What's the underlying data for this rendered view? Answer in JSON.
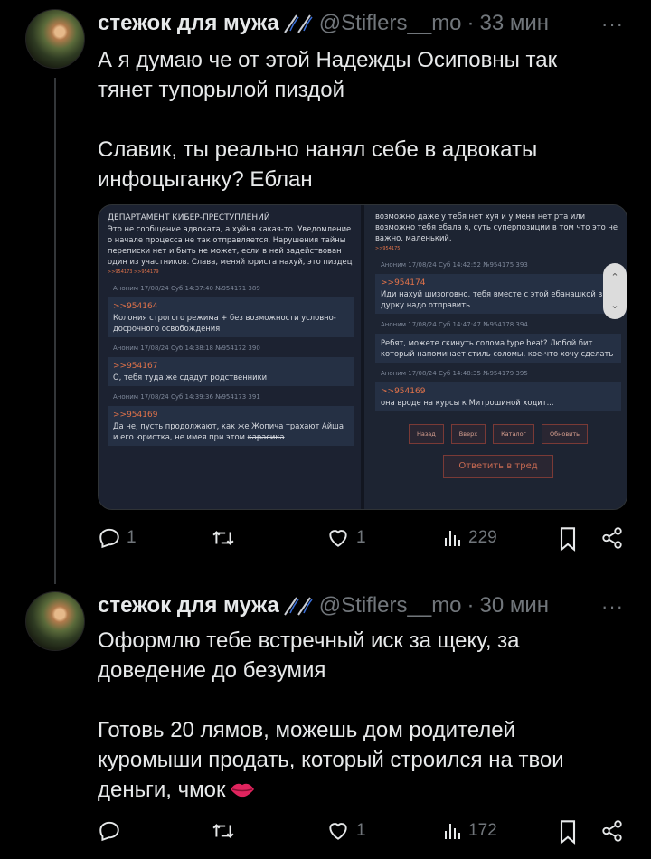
{
  "posts": [
    {
      "display_name": "стежок для мужа",
      "handle": "@Stiflers__mo",
      "separator": "·",
      "time": "33 мин",
      "more": "···",
      "paragraphs": [
        "А я думаю че от этой Надежды Осиповны так тянет тупорылой пиздой",
        "Славик, ты реально нанял себе в адвокаты инфоцыганку? Еблан"
      ],
      "stats": {
        "replies": "1",
        "retweets": "",
        "likes": "1",
        "views": "229"
      }
    },
    {
      "display_name": "стежок для мужа",
      "handle": "@Stiflers__mo",
      "separator": "·",
      "time": "30 мин",
      "more": "···",
      "paragraphs": [
        "Оформлю тебе встречный иск за щеку, за доведение до безумия",
        "Готовь 20 лямов, можешь дом родителей куромыши продать, который строился на твои деньги, чмок"
      ],
      "stats": {
        "replies": "",
        "retweets": "",
        "likes": "1",
        "views": "172"
      }
    }
  ],
  "embed": {
    "left": {
      "op_title": "ДЕПАРТАМЕНТ КИБЕР-ПРЕСТУПЛЕНИЙ",
      "op_text": "Это не сообщение адвоката, а хуйня какая-то. Уведомление о начале процесса не так отправляется. Нарушения тайны переписки нет и быть не может, если в ней задействован один из участников. Слава, меняй юриста нахуй, это пиздец",
      "op_replies": ">>954173 >>954179",
      "posts": [
        {
          "meta": "Аноним  17/08/24 Суб 14:37:40  №954171  389",
          "ref": ">>954164",
          "text": "Колония строгого режима + без возможности условно-досрочного освобождения"
        },
        {
          "meta": "Аноним  17/08/24 Суб 14:38:18  №954172  390",
          "ref": ">>954167",
          "text": "О, тебя туда же сдадут родственники"
        },
        {
          "meta": "Аноним  17/08/24 Суб 14:39:36  №954173  391",
          "ref": ">>954169",
          "text": "Да не, пусть продолжают, как же Жопича трахают Айша и его юристка, не имея при этом",
          "strike": "карасика"
        }
      ]
    },
    "right": {
      "top_text": "возможно даже у тебя нет хуя и у меня нет рта или возможно тебя ебала я, суть суперпозиции в том что это не важно, маленький.",
      "top_replies": ">>954175",
      "posts": [
        {
          "meta": "Аноним  17/08/24 Суб 14:42:52  №954175  393",
          "ref": ">>954174",
          "text": "Иди нахуй шизоговно, тебя вместе с этой ебанашкой в дурку надо отправить"
        },
        {
          "meta": "Аноним  17/08/24 Суб 14:47:47  №954178  394",
          "ref": "",
          "text": "Ребят, можете скинуть солома type beat? Любой бит который напоминает стиль соломы, кое-что хочу сделать"
        },
        {
          "meta": "Аноним  17/08/24 Суб 14:48:35  №954179  395",
          "ref": ">>954169",
          "text": "она вроде на курсы к Митрошиной ходит..."
        }
      ],
      "buttons": [
        "Назад",
        "Вверх",
        "Каталог",
        "Обновить"
      ],
      "reply_button": "Ответить в тред"
    }
  },
  "icons": [
    "reply-icon",
    "retweet-icon",
    "like-icon",
    "views-icon",
    "bookmark-icon",
    "share-icon",
    "needle-emoji-icon",
    "kiss-mark-icon",
    "scroll-up-icon",
    "scroll-down-icon"
  ],
  "colors": {
    "background": "#000000",
    "text": "#e7e9ea",
    "muted": "#71767b",
    "board_bg": "#1c2231",
    "board_accent": "#e2734a"
  }
}
